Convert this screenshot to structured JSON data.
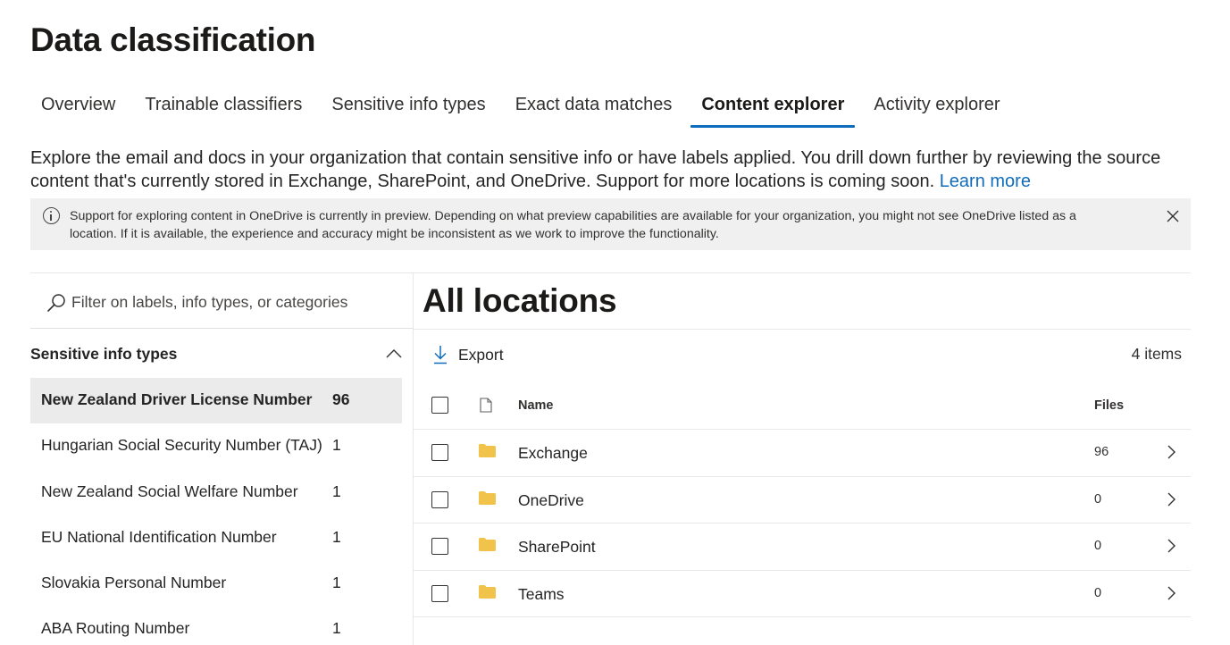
{
  "page": {
    "title": "Data classification"
  },
  "tabs": [
    {
      "label": "Overview",
      "active": false
    },
    {
      "label": "Trainable classifiers",
      "active": false
    },
    {
      "label": "Sensitive info types",
      "active": false
    },
    {
      "label": "Exact data matches",
      "active": false
    },
    {
      "label": "Content explorer",
      "active": true
    },
    {
      "label": "Activity explorer",
      "active": false
    }
  ],
  "description": {
    "text": "Explore the email and docs in your organization that contain sensitive info or have labels applied. You drill down further by reviewing the source content that's currently stored in Exchange, SharePoint, and OneDrive. Support for more locations is coming soon. ",
    "link_label": "Learn more"
  },
  "banner": {
    "icon": "info-icon",
    "text": "Support for exploring content in OneDrive is currently in preview. Depending on what preview capabilities are available for your organization, you might not see OneDrive listed as a location. If it is available, the experience and accuracy might be inconsistent as we work to improve the functionality.",
    "close_icon": "close-icon"
  },
  "filter": {
    "placeholder": "Filter on labels, info types, or categories",
    "value": ""
  },
  "sidebar": {
    "section_title": "Sensitive info types",
    "expanded": true,
    "items": [
      {
        "label": "New Zealand Driver License Number",
        "count": "96",
        "selected": true
      },
      {
        "label": "Hungarian Social Security Number (TAJ)",
        "count": "1",
        "selected": false
      },
      {
        "label": "New Zealand Social Welfare Number",
        "count": "1",
        "selected": false
      },
      {
        "label": "EU National Identification Number",
        "count": "1",
        "selected": false
      },
      {
        "label": "Slovakia Personal Number",
        "count": "1",
        "selected": false
      },
      {
        "label": "ABA Routing Number",
        "count": "1",
        "selected": false
      }
    ]
  },
  "main": {
    "title": "All locations",
    "export_label": "Export",
    "items_count": "4 items",
    "columns": {
      "name": "Name",
      "files": "Files"
    },
    "rows": [
      {
        "name": "Exchange",
        "files": "96"
      },
      {
        "name": "OneDrive",
        "files": "0"
      },
      {
        "name": "SharePoint",
        "files": "0"
      },
      {
        "name": "Teams",
        "files": "0"
      }
    ]
  },
  "colors": {
    "accent": "#0f6cbd",
    "folder": "#f2c34b",
    "banner_bg": "#f0f0f0",
    "selected_row_bg": "#ebebeb"
  }
}
